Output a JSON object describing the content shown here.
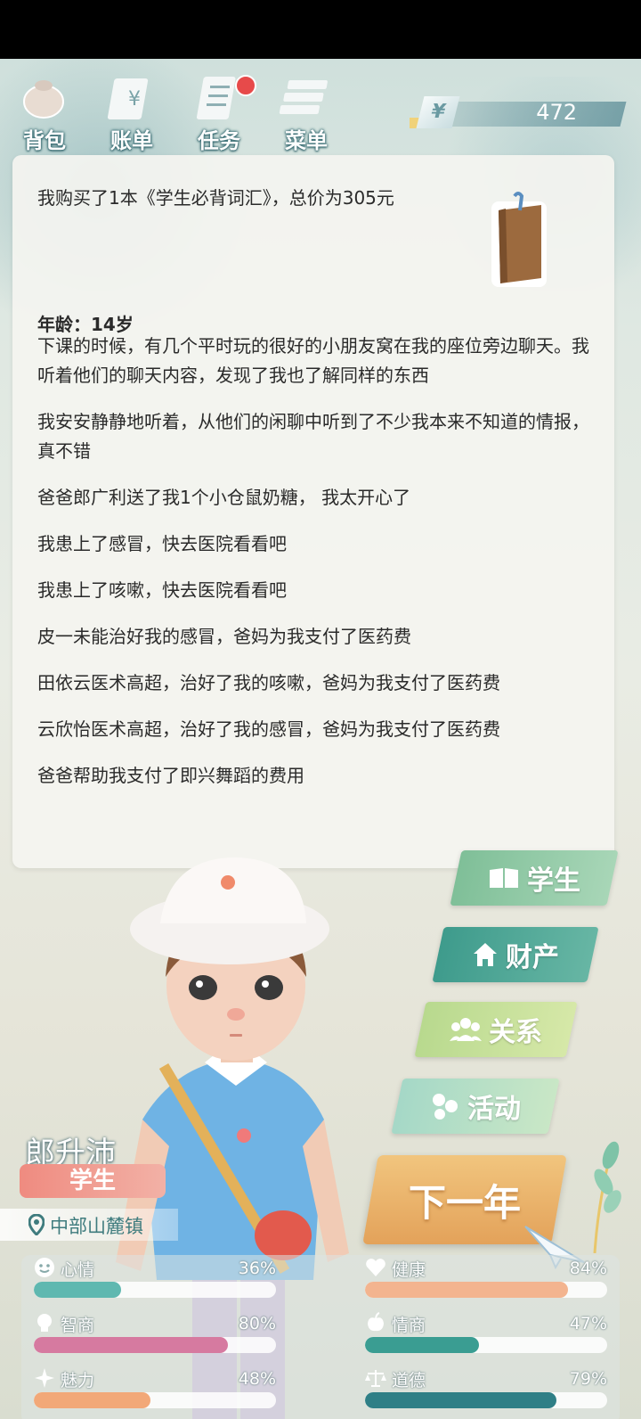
{
  "nav": {
    "items": [
      {
        "label": "背包"
      },
      {
        "label": "账单"
      },
      {
        "label": "任务"
      },
      {
        "label": "菜单"
      }
    ]
  },
  "money": {
    "value": "472",
    "symbol": "¥"
  },
  "log": {
    "first": "我购买了1本《学生必背词汇》，总价为305元",
    "age": "年龄：14岁",
    "entries": [
      "下课的时候，有几个平时玩的很好的小朋友窝在我的座位旁边聊天。我听着他们的聊天内容，发现了我也了解同样的东西",
      "我安安静静地听着，从他们的闲聊中听到了不少我本来不知道的情报，真不错",
      "爸爸郎广利送了我1个小仓鼠奶糖， 我太开心了",
      "我患上了感冒，快去医院看看吧",
      "我患上了咳嗽，快去医院看看吧",
      "皮一未能治好我的感冒，爸妈为我支付了医药费",
      "田依云医术高超，治好了我的咳嗽，爸妈为我支付了医药费",
      "云欣怡医术高超，治好了我的感冒，爸妈为我支付了医药费",
      "爸爸帮助我支付了即兴舞蹈的费用"
    ]
  },
  "actions": {
    "student": "学生",
    "assets": "财产",
    "relations": "关系",
    "activities": "活动",
    "next_year": "下一年"
  },
  "character": {
    "name": "郎升沛",
    "role": "学生",
    "location": "中部山麓镇"
  },
  "stats": [
    {
      "label": "心情",
      "pct": "36%",
      "value": 0.36,
      "color": "#5fb8b0",
      "icon": "smile-icon"
    },
    {
      "label": "健康",
      "pct": "84%",
      "value": 0.84,
      "color": "#f3b48f",
      "icon": "heart-icon"
    },
    {
      "label": "智商",
      "pct": "80%",
      "value": 0.8,
      "color": "#d67aa0",
      "icon": "bulb-icon"
    },
    {
      "label": "情商",
      "pct": "47%",
      "value": 0.47,
      "color": "#3a9d92",
      "icon": "apple-icon"
    },
    {
      "label": "魅力",
      "pct": "48%",
      "value": 0.48,
      "color": "#f2a878",
      "icon": "sparkle-icon"
    },
    {
      "label": "道德",
      "pct": "79%",
      "value": 0.79,
      "color": "#2f7f86",
      "icon": "scale-icon"
    }
  ]
}
